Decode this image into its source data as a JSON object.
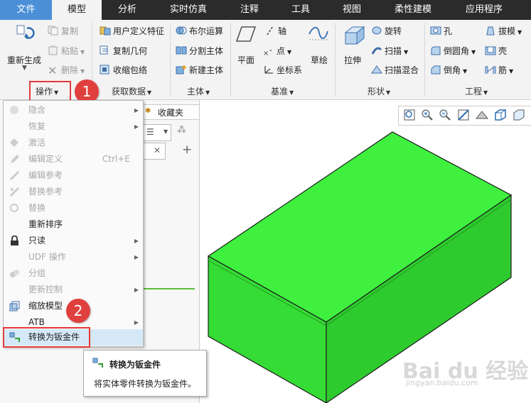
{
  "tabs": [
    "文件",
    "模型",
    "分析",
    "实时仿真",
    "注释",
    "工具",
    "视图",
    "柔性建模",
    "应用程序"
  ],
  "ribbon": {
    "regen": "重新生成",
    "copy": "复制",
    "paste": "粘贴",
    "delete": "删除",
    "udf": "用户定义特征",
    "copy_geom": "复制几何",
    "shrinkwrap": "收缩包络",
    "boolean": "布尔运算",
    "split_body": "分割主体",
    "new_body": "新建主体",
    "plane": "平面",
    "axis": "轴",
    "point": "点",
    "csys": "坐标系",
    "sketch": "草绘",
    "extrude": "拉伸",
    "revolve": "旋转",
    "sweep": "扫描",
    "swept_blend": "扫描混合",
    "hole": "孔",
    "round": "倒圆角",
    "chamfer": "倒角",
    "draft": "拔模",
    "shell": "壳",
    "rib": "筋",
    "groups": {
      "operations": "操作",
      "get_data": "获取数据",
      "body": "主体",
      "datum": "基准",
      "shapes": "形状",
      "engineering": "工程"
    }
  },
  "panel": {
    "favorites_tab": "收藏夹"
  },
  "menu": {
    "items": [
      {
        "label": "隐含",
        "arrow": "▶"
      },
      {
        "label": "恢复",
        "arrow": "▶"
      },
      {
        "label": "激活"
      },
      {
        "label": "编辑定义",
        "shortcut": "Ctrl+E"
      },
      {
        "label": "编辑参考"
      },
      {
        "label": "替换参考"
      },
      {
        "label": "替换"
      },
      {
        "label": "重新排序"
      },
      {
        "label": "只读",
        "arrow": "▶"
      },
      {
        "label": "UDF 操作",
        "arrow": "▶"
      },
      {
        "label": "分组"
      },
      {
        "label": "更新控制",
        "arrow": "▶"
      },
      {
        "label": "缩放模型"
      },
      {
        "label": "ATB",
        "arrow": "▶"
      },
      {
        "label": "转换为钣金件"
      }
    ]
  },
  "tooltip": {
    "title": "转换为钣金件",
    "desc": "将实体零件转换为钣金件。"
  },
  "badges": [
    "1",
    "2"
  ],
  "watermark": {
    "brand": "Bai du 经验",
    "url": "jingyan.baidu.com"
  },
  "colors": {
    "model_top": "#3ff03f",
    "model_front": "#35dc35",
    "model_side": "#2ecb2e",
    "accent": "#4a8fd8",
    "highlight_red": "#e53a3a"
  }
}
